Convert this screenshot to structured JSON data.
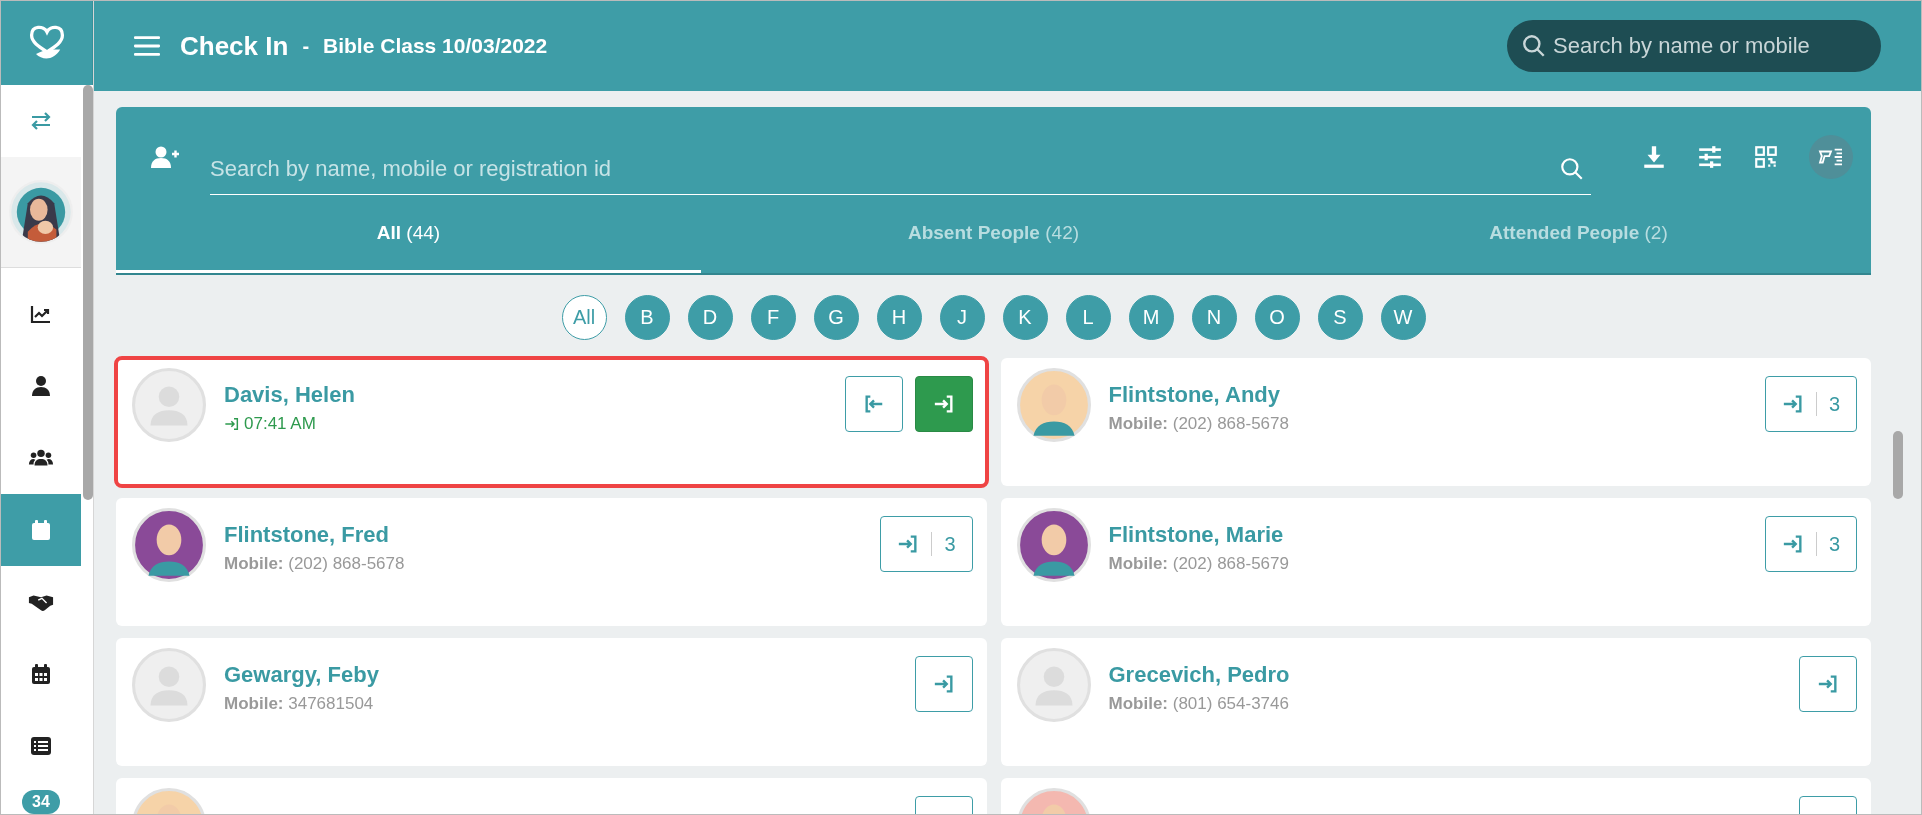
{
  "header": {
    "title": "Check In",
    "separator": "-",
    "subtitle": "Bible Class 10/03/2022",
    "search": {
      "placeholder": "Search by name or mobile"
    }
  },
  "sidebar": {
    "items": [
      {
        "kind": "swap",
        "selected": false
      },
      {
        "kind": "logo",
        "selected": false
      },
      {
        "kind": "chart",
        "selected": false
      },
      {
        "kind": "person",
        "selected": false
      },
      {
        "kind": "people",
        "selected": false
      },
      {
        "kind": "calendar",
        "selected": true
      },
      {
        "kind": "handshake",
        "selected": false
      },
      {
        "kind": "calendar-grid",
        "selected": false
      },
      {
        "kind": "list",
        "selected": false
      }
    ],
    "badge": "34"
  },
  "search": {
    "placeholder": "Search by name, mobile or registration id"
  },
  "tabs": [
    {
      "label": "All",
      "count": "(44)",
      "selected": true
    },
    {
      "label": "Absent People",
      "count": "(42)",
      "selected": false
    },
    {
      "label": "Attended People",
      "count": "(2)",
      "selected": false
    }
  ],
  "letters": [
    {
      "label": "All",
      "selected": true
    },
    {
      "label": "B",
      "selected": false
    },
    {
      "label": "D",
      "selected": false
    },
    {
      "label": "F",
      "selected": false
    },
    {
      "label": "G",
      "selected": false
    },
    {
      "label": "H",
      "selected": false
    },
    {
      "label": "J",
      "selected": false
    },
    {
      "label": "K",
      "selected": false
    },
    {
      "label": "L",
      "selected": false
    },
    {
      "label": "M",
      "selected": false
    },
    {
      "label": "N",
      "selected": false
    },
    {
      "label": "O",
      "selected": false
    },
    {
      "label": "S",
      "selected": false
    },
    {
      "label": "W",
      "selected": false
    }
  ],
  "people": [
    {
      "name": "Davis, Helen",
      "highlighted": true,
      "avatar": {
        "kind": "generic"
      },
      "time": "07:41 AM",
      "checkout": true,
      "checkin_active": true
    },
    {
      "name": "Flintstone, Andy",
      "highlighted": false,
      "avatar": {
        "kind": "drawn",
        "color": "#f6d3a8"
      },
      "mobile_label": "Mobile:",
      "mobile": "(202) 868-5678",
      "checkout": false,
      "checkin_active": false,
      "count": "3"
    },
    {
      "name": "Flintstone, Fred",
      "highlighted": false,
      "avatar": {
        "kind": "drawn",
        "color": "#8a4a98"
      },
      "mobile_label": "Mobile:",
      "mobile": "(202) 868-5678",
      "checkout": false,
      "checkin_active": false,
      "count": "3"
    },
    {
      "name": "Flintstone, Marie",
      "highlighted": false,
      "avatar": {
        "kind": "drawn",
        "color": "#8a4a98"
      },
      "mobile_label": "Mobile:",
      "mobile": "(202) 868-5679",
      "checkout": false,
      "checkin_active": false,
      "count": "3"
    },
    {
      "name": "Gewargy, Feby",
      "highlighted": false,
      "avatar": {
        "kind": "generic"
      },
      "mobile_label": "Mobile:",
      "mobile": "347681504",
      "checkout": false,
      "checkin_active": false
    },
    {
      "name": "Grecevich, Pedro",
      "highlighted": false,
      "avatar": {
        "kind": "generic"
      },
      "mobile_label": "Mobile:",
      "mobile": "(801) 654-3746",
      "checkout": false,
      "checkin_active": false
    },
    {
      "highlighted": false,
      "avatar": {
        "kind": "drawn",
        "color": "#f6d3a8"
      },
      "checkout": false,
      "checkin_active": false
    },
    {
      "highlighted": false,
      "avatar": {
        "kind": "drawn",
        "color": "#f4b8b0"
      },
      "checkout": false,
      "checkin_active": false
    }
  ]
}
